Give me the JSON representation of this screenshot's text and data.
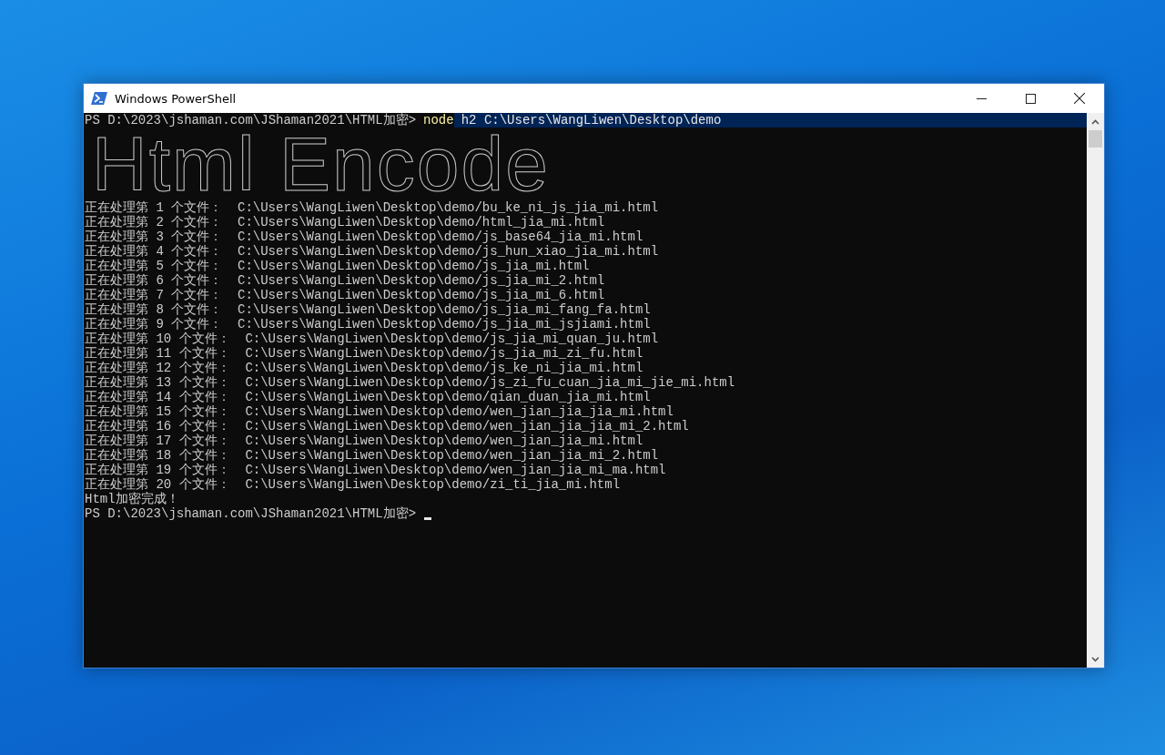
{
  "window": {
    "title": "Windows PowerShell"
  },
  "console": {
    "lines": [
      {
        "kind": "command",
        "prompt": "PS D:\\2023\\jshaman.com\\JShaman2021\\HTML加密>",
        "command": "node",
        "args": "h2 C:\\Users\\WangLiwen\\Desktop\\demo",
        "highlighted": true
      },
      {
        "kind": "banner",
        "text": "Html Encode"
      },
      {
        "kind": "output",
        "text": "正在处理第 1 个文件：  C:\\Users\\WangLiwen\\Desktop\\demo/bu_ke_ni_js_jia_mi.html"
      },
      {
        "kind": "output",
        "text": "正在处理第 2 个文件：  C:\\Users\\WangLiwen\\Desktop\\demo/html_jia_mi.html"
      },
      {
        "kind": "output",
        "text": "正在处理第 3 个文件：  C:\\Users\\WangLiwen\\Desktop\\demo/js_base64_jia_mi.html"
      },
      {
        "kind": "output",
        "text": "正在处理第 4 个文件：  C:\\Users\\WangLiwen\\Desktop\\demo/js_hun_xiao_jia_mi.html"
      },
      {
        "kind": "output",
        "text": "正在处理第 5 个文件：  C:\\Users\\WangLiwen\\Desktop\\demo/js_jia_mi.html"
      },
      {
        "kind": "output",
        "text": "正在处理第 6 个文件：  C:\\Users\\WangLiwen\\Desktop\\demo/js_jia_mi_2.html"
      },
      {
        "kind": "output",
        "text": "正在处理第 7 个文件：  C:\\Users\\WangLiwen\\Desktop\\demo/js_jia_mi_6.html"
      },
      {
        "kind": "output",
        "text": "正在处理第 8 个文件：  C:\\Users\\WangLiwen\\Desktop\\demo/js_jia_mi_fang_fa.html"
      },
      {
        "kind": "output",
        "text": "正在处理第 9 个文件：  C:\\Users\\WangLiwen\\Desktop\\demo/js_jia_mi_jsjiami.html"
      },
      {
        "kind": "output",
        "text": "正在处理第 10 个文件：  C:\\Users\\WangLiwen\\Desktop\\demo/js_jia_mi_quan_ju.html"
      },
      {
        "kind": "output",
        "text": "正在处理第 11 个文件：  C:\\Users\\WangLiwen\\Desktop\\demo/js_jia_mi_zi_fu.html"
      },
      {
        "kind": "output",
        "text": "正在处理第 12 个文件：  C:\\Users\\WangLiwen\\Desktop\\demo/js_ke_ni_jia_mi.html"
      },
      {
        "kind": "output",
        "text": "正在处理第 13 个文件：  C:\\Users\\WangLiwen\\Desktop\\demo/js_zi_fu_cuan_jia_mi_jie_mi.html"
      },
      {
        "kind": "output",
        "text": "正在处理第 14 个文件：  C:\\Users\\WangLiwen\\Desktop\\demo/qian_duan_jia_mi.html"
      },
      {
        "kind": "output",
        "text": "正在处理第 15 个文件：  C:\\Users\\WangLiwen\\Desktop\\demo/wen_jian_jia_jia_mi.html"
      },
      {
        "kind": "output",
        "text": "正在处理第 16 个文件：  C:\\Users\\WangLiwen\\Desktop\\demo/wen_jian_jia_jia_mi_2.html"
      },
      {
        "kind": "output",
        "text": "正在处理第 17 个文件：  C:\\Users\\WangLiwen\\Desktop\\demo/wen_jian_jia_mi.html"
      },
      {
        "kind": "output",
        "text": "正在处理第 18 个文件：  C:\\Users\\WangLiwen\\Desktop\\demo/wen_jian_jia_mi_2.html"
      },
      {
        "kind": "output",
        "text": "正在处理第 19 个文件：  C:\\Users\\WangLiwen\\Desktop\\demo/wen_jian_jia_mi_ma.html"
      },
      {
        "kind": "output",
        "text": "正在处理第 20 个文件：  C:\\Users\\WangLiwen\\Desktop\\demo/zi_ti_jia_mi.html"
      },
      {
        "kind": "output",
        "text": "Html加密完成！"
      },
      {
        "kind": "prompt",
        "prompt": "PS D:\\2023\\jshaman.com\\JShaman2021\\HTML加密>",
        "cursor": true
      }
    ]
  }
}
